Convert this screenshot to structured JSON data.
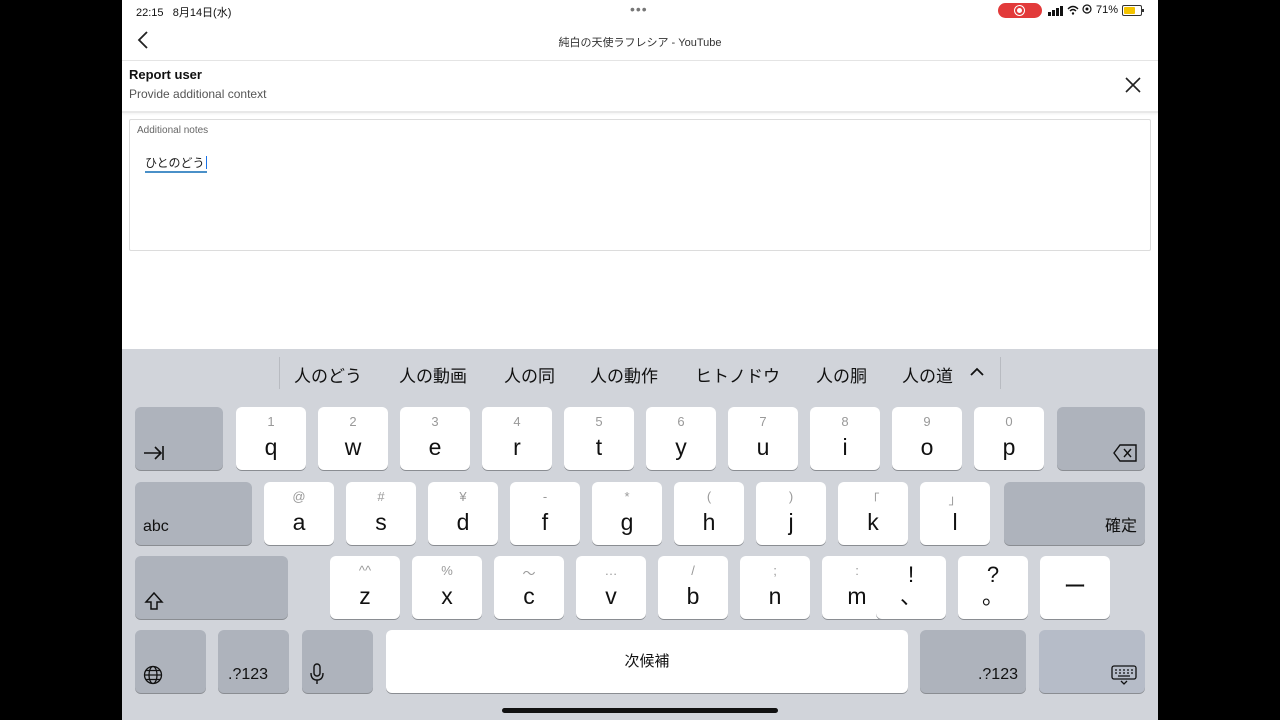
{
  "status": {
    "time": "22:15",
    "date": "8月14日(水)",
    "battery": "71%",
    "battery_level": 0.71
  },
  "nav": {
    "title": "純白の天使ラフレシア - YouTube"
  },
  "dialog": {
    "title": "Report user",
    "subtitle": "Provide additional context"
  },
  "notes": {
    "label": "Additional notes",
    "value": "ひとのどう"
  },
  "candidates": [
    "人のどう",
    "人の動画",
    "人の同",
    "人の動作",
    "ヒトノドウ",
    "人の胴",
    "人の道"
  ],
  "keyboard": {
    "row1": [
      {
        "sub": "1",
        "main": "q"
      },
      {
        "sub": "2",
        "main": "w"
      },
      {
        "sub": "3",
        "main": "e"
      },
      {
        "sub": "4",
        "main": "r"
      },
      {
        "sub": "5",
        "main": "t"
      },
      {
        "sub": "6",
        "main": "y"
      },
      {
        "sub": "7",
        "main": "u"
      },
      {
        "sub": "8",
        "main": "i"
      },
      {
        "sub": "9",
        "main": "o"
      },
      {
        "sub": "0",
        "main": "p"
      }
    ],
    "row2": [
      {
        "sub": "@",
        "main": "a"
      },
      {
        "sub": "#",
        "main": "s"
      },
      {
        "sub": "¥",
        "main": "d"
      },
      {
        "sub": "-",
        "main": "f"
      },
      {
        "sub": "*",
        "main": "g"
      },
      {
        "sub": "(",
        "main": "h"
      },
      {
        "sub": ")",
        "main": "j"
      },
      {
        "sub": "「",
        "main": "k"
      },
      {
        "sub": "」",
        "main": "l"
      }
    ],
    "row3": [
      {
        "sub": "^^",
        "main": "z"
      },
      {
        "sub": "%",
        "main": "x"
      },
      {
        "sub": "〜",
        "main": "c"
      },
      {
        "sub": "…",
        "main": "v"
      },
      {
        "sub": "/",
        "main": "b"
      },
      {
        "sub": ";",
        "main": "n"
      },
      {
        "sub": ":",
        "main": "m"
      }
    ],
    "punct1": {
      "top": "!",
      "bottom": "、"
    },
    "punct2": {
      "top": "?",
      "bottom": "。"
    },
    "dash": "ー",
    "abc": "abc",
    "confirm": "確定",
    "num_left": ".?123",
    "num_right": ".?123",
    "space": "次候補"
  }
}
